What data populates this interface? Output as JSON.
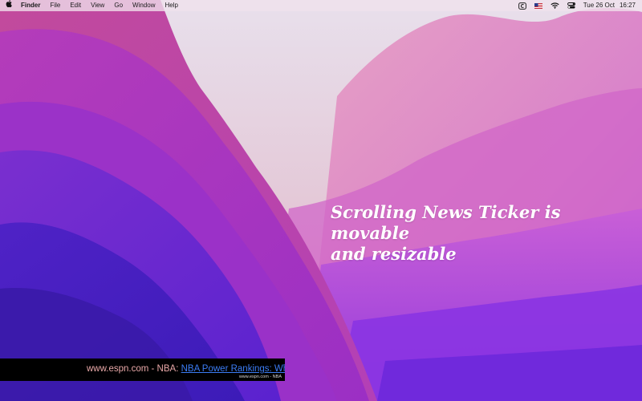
{
  "menubar": {
    "app_name": "Finder",
    "menus": [
      "File",
      "Edit",
      "View",
      "Go",
      "Window",
      "Help"
    ],
    "status_icons": [
      "ticker-app-icon",
      "us-flag-icon",
      "wifi-icon",
      "control-center-icon"
    ],
    "date": "Tue 26 Oct",
    "time": "16:27"
  },
  "caption": {
    "line1": "Scrolling News Ticker is movable",
    "line2": "and resizable"
  },
  "ticker": {
    "source": "www.espn.com - NBA: ",
    "headline": "NBA Power Rankings: Whic",
    "sub_source": "www.espn.com - NBA"
  },
  "colors": {
    "ticker_source": "#e9a8a8",
    "ticker_link": "#3b7cf4",
    "ticker_background": "#000000"
  }
}
